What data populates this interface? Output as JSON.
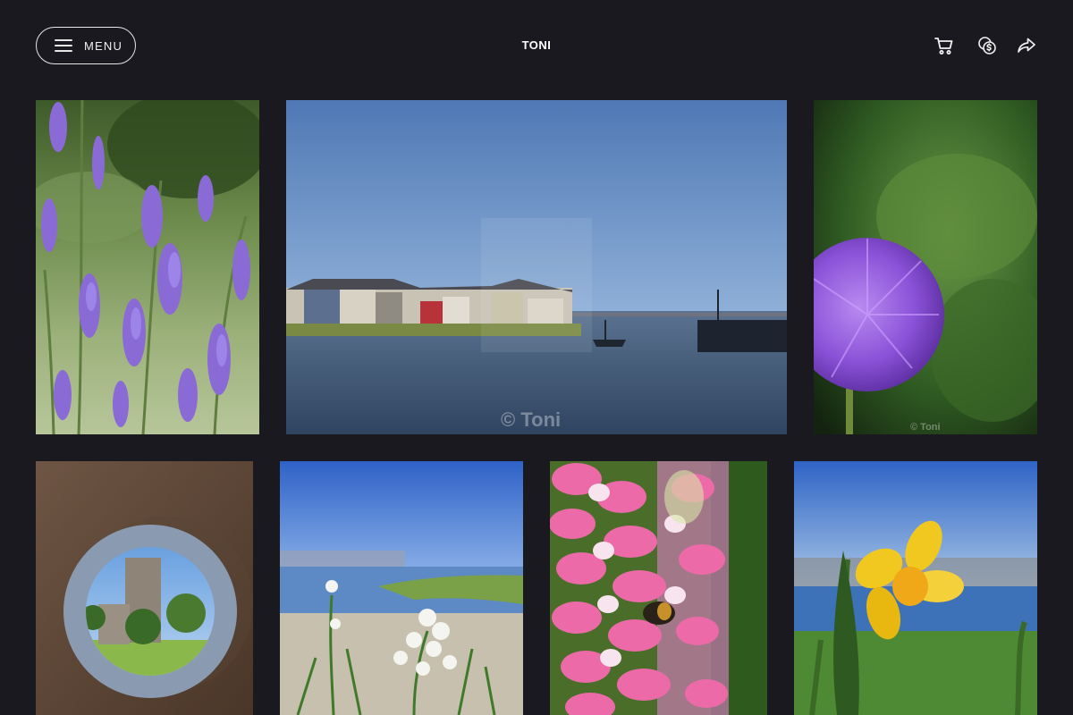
{
  "header": {
    "menu_label": "MENU",
    "title": "TONI",
    "icons": [
      "cart-icon",
      "currency-coins-icon",
      "share-icon"
    ]
  },
  "gallery": {
    "photos": [
      {
        "subject": "lavender-flowers",
        "watermark": ""
      },
      {
        "subject": "harbour-houses",
        "watermark": "© Toni"
      },
      {
        "subject": "purple-allium",
        "watermark": "© Toni"
      },
      {
        "subject": "castle-through-hole",
        "watermark": ""
      },
      {
        "subject": "white-flowers-by-water",
        "watermark": ""
      },
      {
        "subject": "pink-lupin-with-bee",
        "watermark": ""
      },
      {
        "subject": "yellow-daffodil",
        "watermark": ""
      }
    ]
  },
  "colors": {
    "background": "#1b1920",
    "text": "#ffffff",
    "button_border": "#e6e6e6"
  }
}
